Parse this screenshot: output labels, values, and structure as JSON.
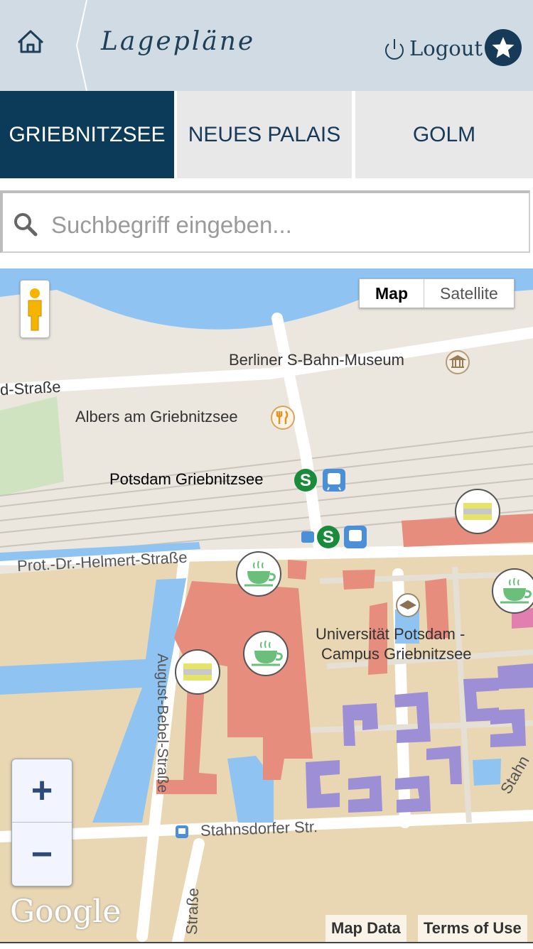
{
  "header": {
    "title": "Lagepläne",
    "logout_label": "Logout"
  },
  "tabs": [
    {
      "label": "GRIEBNITZSEE",
      "active": true
    },
    {
      "label": "NEUES PALAIS",
      "active": false
    },
    {
      "label": "GOLM",
      "active": false
    }
  ],
  "search": {
    "placeholder": "Suchbegriff eingeben..."
  },
  "map": {
    "type_options": [
      "Map",
      "Satellite"
    ],
    "selected_type": "Map",
    "labels": {
      "museum": "Berliner S-Bahn-Museum",
      "street_top": "d-Straße",
      "restaurant": "Albers am Griebnitzsee",
      "station": "Potsdam Griebnitzsee",
      "helmert": "Prot.-Dr.-Helmert-Straße",
      "august": "August-Bebel-Straße",
      "campus_line1": "Universität Potsdam -",
      "campus_line2": "Campus Griebnitzsee",
      "stahnsdorfer": "Stahnsdorfer Str.",
      "strasse_bottom": "Straße",
      "stahn_right": "Stahn"
    },
    "zoom_in": "+",
    "zoom_out": "−",
    "google_logo": "Google",
    "attribution_data": "Map Data",
    "attribution_terms": "Terms of Use"
  },
  "colors": {
    "header_bg": "#d1dbe3",
    "brand_dark": "#0b3b58",
    "tab_inactive_bg": "#e8e8e8",
    "water": "#8fc4f2",
    "campus": "#e9d7b3",
    "building": "#e68d7e",
    "student_housing": "#9d8fd6"
  }
}
